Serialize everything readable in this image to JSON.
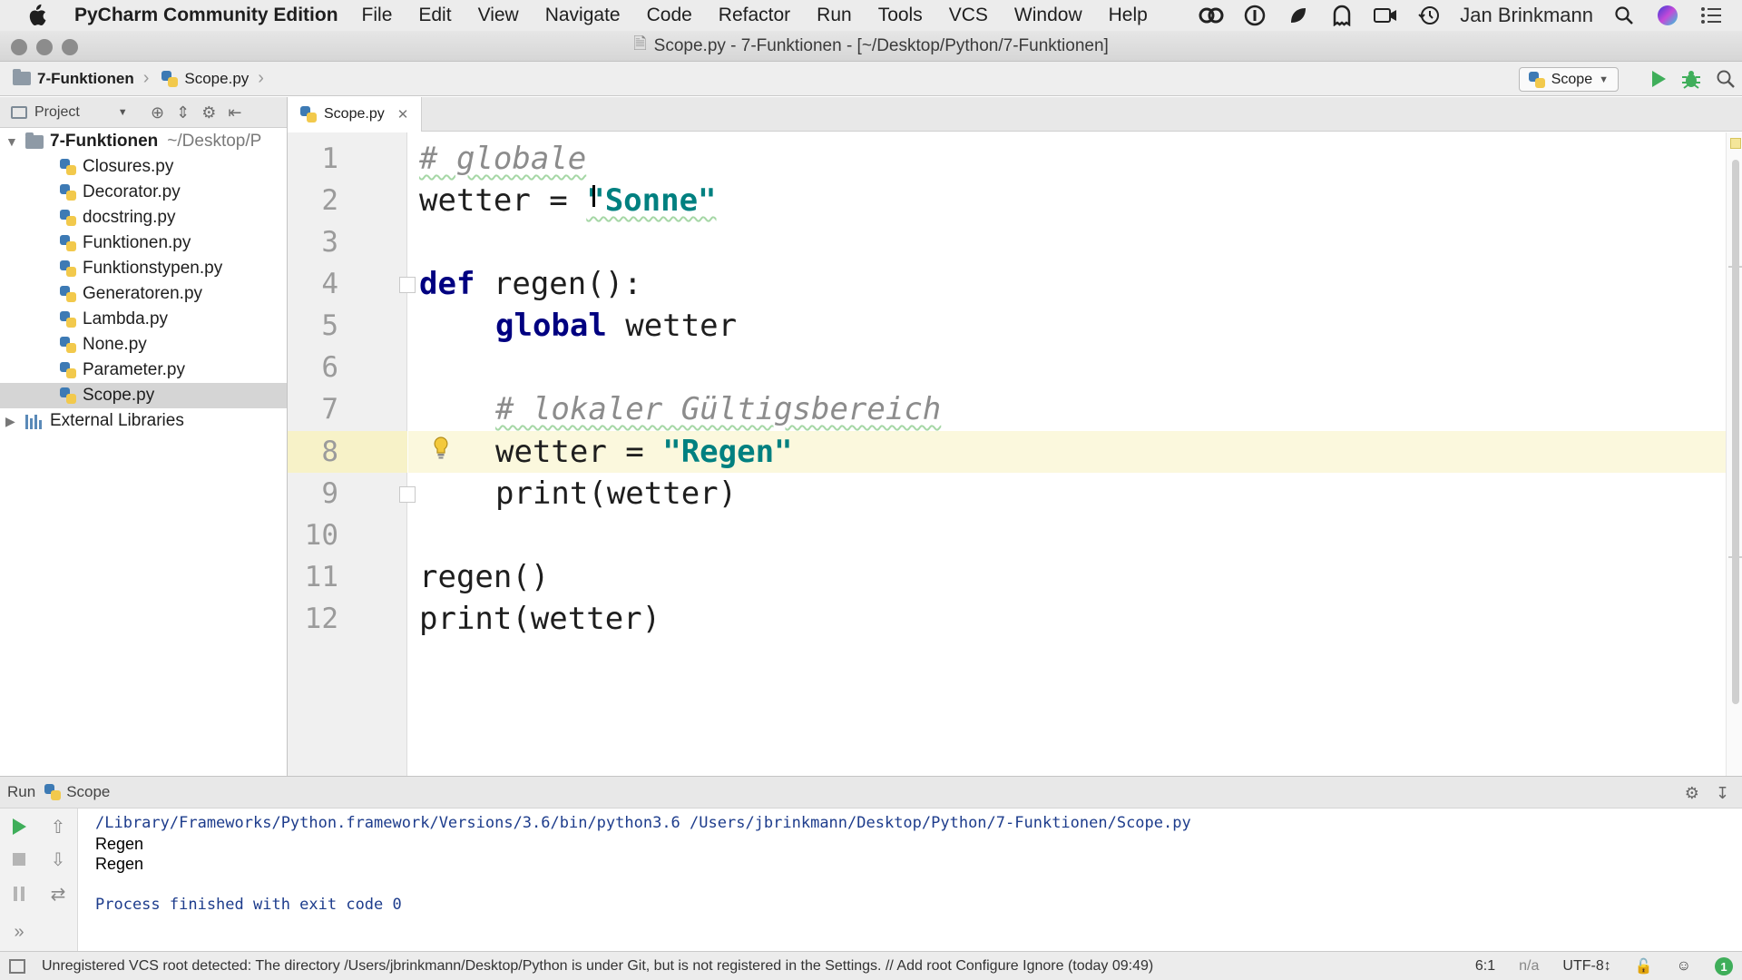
{
  "menubar": {
    "app_name": "PyCharm Community Edition",
    "menus": [
      "File",
      "Edit",
      "View",
      "Navigate",
      "Code",
      "Refactor",
      "Run",
      "Tools",
      "VCS",
      "Window",
      "Help"
    ],
    "user": "Jan Brinkmann"
  },
  "window": {
    "title": "Scope.py - 7-Funktionen - [~/Desktop/Python/7-Funktionen]"
  },
  "navbar": {
    "breadcrumb": [
      "7-Funktionen",
      "Scope.py"
    ],
    "run_config": "Scope"
  },
  "project": {
    "header_label": "Project",
    "root_name": "7-Funktionen",
    "root_path": "~/Desktop/P",
    "files": [
      "Closures.py",
      "Decorator.py",
      "docstring.py",
      "Funktionen.py",
      "Funktionstypen.py",
      "Generatoren.py",
      "Lambda.py",
      "None.py",
      "Parameter.py",
      "Scope.py"
    ],
    "selected_file": "Scope.py",
    "external": "External Libraries"
  },
  "editor": {
    "tab_label": "Scope.py",
    "line_numbers": [
      "1",
      "2",
      "3",
      "4",
      "5",
      "6",
      "7",
      "8",
      "9",
      "10",
      "11",
      "12"
    ],
    "code": {
      "l1_comment": "# globale",
      "l2_var": "wetter = ",
      "l2_str": "\"Sonne\"",
      "l4_kw": "def",
      "l4_rest": " regen():",
      "l5_kw": "global",
      "l5_rest": " wetter",
      "l7_comment": "# lokaler Gültigsbereich",
      "l8_var": "wetter = ",
      "l8_str": "\"Regen\"",
      "l9": "print(wetter)",
      "l11": "regen()",
      "l12": "print(wetter)"
    },
    "highlighted_line": "8"
  },
  "run": {
    "label": "Run",
    "config": "Scope",
    "output": {
      "command": "/Library/Frameworks/Python.framework/Versions/3.6/bin/python3.6 /Users/jbrinkmann/Desktop/Python/7-Funktionen/Scope.py",
      "line1": "Regen",
      "line2": "Regen",
      "exit": "Process finished with exit code 0"
    }
  },
  "statusbar": {
    "message": "Unregistered VCS root detected: The directory /Users/jbrinkmann/Desktop/Python is under Git, but is not registered in the Settings. // Add root  Configure  Ignore (today 09:49)",
    "position": "6:1",
    "na": "n/a",
    "encoding": "UTF-8↕",
    "badge": "1"
  },
  "colors": {
    "keyword": "#000080",
    "string": "#008080",
    "comment": "#8c8c8c",
    "caret_row": "#fbf8dd",
    "run_green": "#3fae5a"
  }
}
